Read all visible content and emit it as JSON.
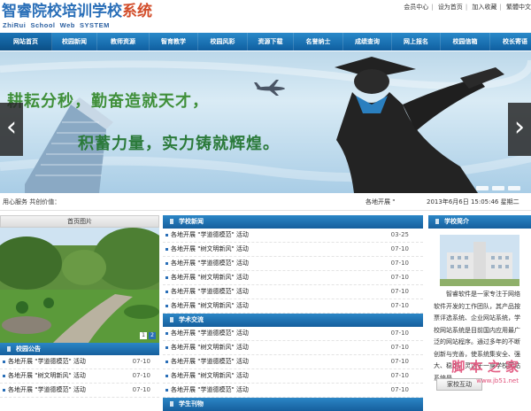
{
  "header": {
    "logo_cn_part1": "智睿院校培训学校",
    "logo_cn_part2": "系统",
    "logo_en": "ZhiRui  School  Web  SYSTEM",
    "top_links": [
      "会员中心",
      "设为首页",
      "加入收藏",
      "繁體中文"
    ]
  },
  "nav": {
    "items": [
      "网站首页",
      "校园新闻",
      "教师资源",
      "智育教学",
      "校园风彩",
      "资源下载",
      "名誉纳士",
      "成绩查询",
      "网上报名",
      "校园信箱",
      "校长寄语"
    ]
  },
  "banner": {
    "slogan_line1": "耕耘分秒，勤奋造就天才，",
    "slogan_line2": "积蓄力量，实力铸就辉煌。"
  },
  "ticker": {
    "left": "用心服务 共创价值：",
    "middle": "各地开展 \"",
    "datetime": "2013年6月6日 15:05:46 星期二"
  },
  "photo_box": {
    "title": "首页图片",
    "pages": [
      "1",
      "2"
    ]
  },
  "notice": {
    "title": "校园公告",
    "rows": [
      {
        "text": "各地开展 \"学道德模范\" 活动",
        "date": "07-10"
      },
      {
        "text": "各地开展 \"树文明新风\" 活动",
        "date": "07-10"
      },
      {
        "text": "各地开展 \"学道德模范\" 活动",
        "date": "07-10"
      }
    ]
  },
  "news": {
    "title": "学校新闻",
    "rows": [
      {
        "text": "各地开展 \"学道德模范\" 活动",
        "date": "03-25"
      },
      {
        "text": "各地开展 \"树文明新风\" 活动",
        "date": "07-10"
      },
      {
        "text": "各地开展 \"学道德模范\" 活动",
        "date": "07-10"
      },
      {
        "text": "各地开展 \"树文明新风\" 活动",
        "date": "07-10"
      },
      {
        "text": "各地开展 \"学道德模范\" 活动",
        "date": "07-10"
      },
      {
        "text": "各地开展 \"树文明新风\" 活动",
        "date": "07-10"
      }
    ]
  },
  "academic": {
    "title": "学术交流",
    "rows": [
      {
        "text": "各地开展 \"学道德模范\" 活动",
        "date": "07-10"
      },
      {
        "text": "各地开展 \"树文明新风\" 活动",
        "date": "07-10"
      },
      {
        "text": "各地开展 \"学道德模范\" 活动",
        "date": "07-10"
      },
      {
        "text": "各地开展 \"树文明新风\" 活动",
        "date": "07-10"
      },
      {
        "text": "各地开展 \"学道德模范\" 活动",
        "date": "07-10"
      }
    ]
  },
  "journal": {
    "title": "学生刊物"
  },
  "intro": {
    "title": "学校简介",
    "text": "智睿软件是一家专注于网络软件开发的工作团队，其产品按票评选系统、企业网站系统，学校网站系统是目前国内应用最广泛的网站程序。通过多年的不断创新与完善，使系统集安全、强大、稳定、灵活于一身学校网站系统是",
    "button": "家校互动"
  },
  "watermark": {
    "text": "脚 本 之 家",
    "sub": "www.jb51.net"
  }
}
